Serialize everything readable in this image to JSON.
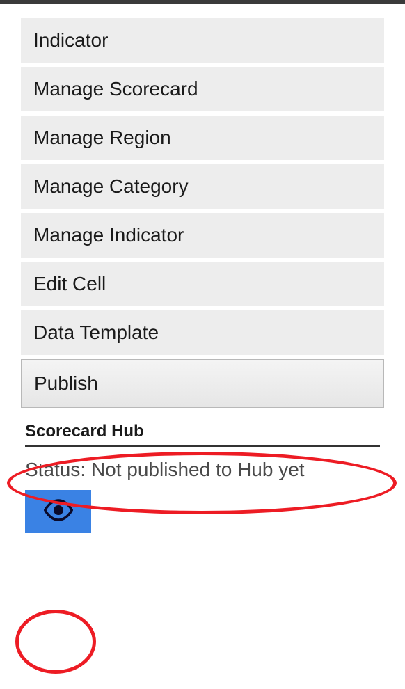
{
  "menu": {
    "items": [
      {
        "label": "Indicator"
      },
      {
        "label": "Manage Scorecard"
      },
      {
        "label": "Manage Region"
      },
      {
        "label": "Manage Category"
      },
      {
        "label": "Manage Indicator"
      },
      {
        "label": "Edit Cell"
      },
      {
        "label": "Data Template"
      }
    ],
    "publish_label": "Publish"
  },
  "hub": {
    "heading": "Scorecard Hub",
    "status": "Status: Not published to Hub yet"
  }
}
